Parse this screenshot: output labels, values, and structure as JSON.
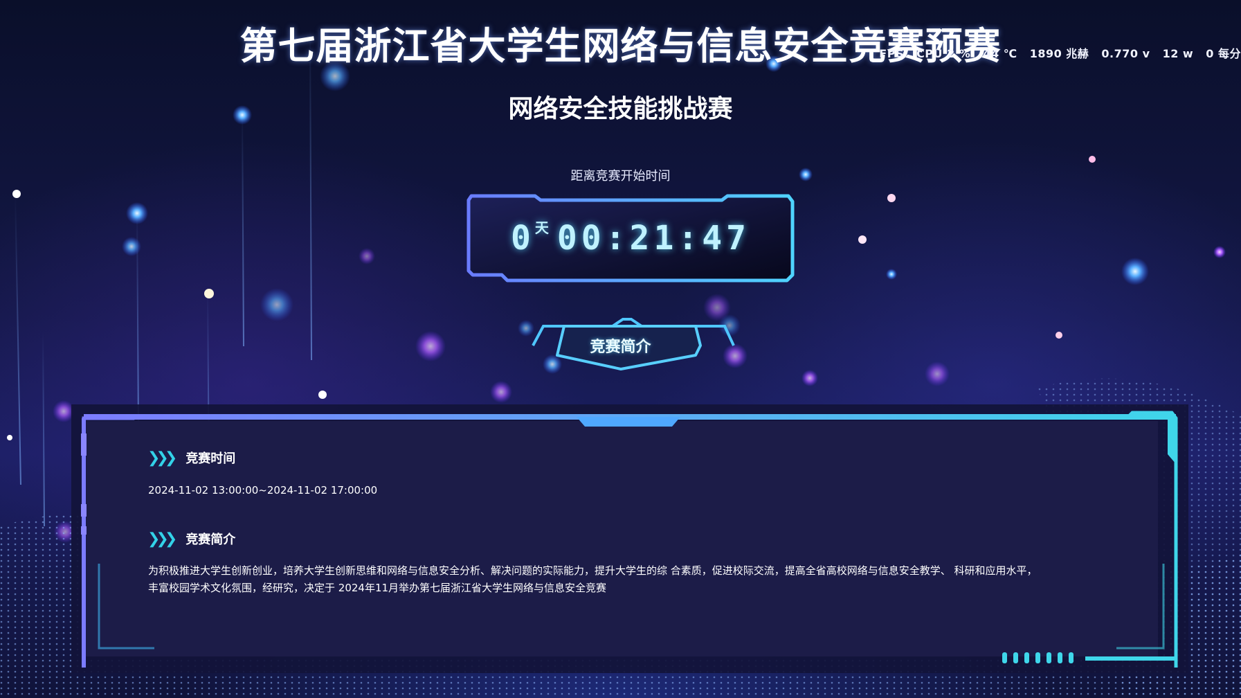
{
  "header": {
    "title": "第七届浙江省大学生网络与信息安全竞赛预赛",
    "subtitle": "网络安全技能挑战赛"
  },
  "perf_overlay": {
    "fps_label": "FPS",
    "cpu": "CPU 2 %",
    "temp": "44 ℃",
    "freq": "1890 兆赫",
    "volt": "0.770 v",
    "power": "12 w",
    "extra": "0 每分"
  },
  "countdown": {
    "label": "距离竞赛开始时间",
    "days": "0",
    "days_unit": "天",
    "time": "00:21:47"
  },
  "tab": {
    "label": "竞赛简介"
  },
  "info": {
    "time_heading": "竞赛时间",
    "time_value": "2024-11-02 13:00:00~2024-11-02 17:00:00",
    "intro_heading": "竞赛简介",
    "intro_line1": "为积极推进大学生创新创业，培养大学生创新思维和网络与信息安全分析、解决问题的实际能力，提升大学生的综 合素质，促进校际交流，提高全省高校网络与信息安全教学、 科研和应用水平，",
    "intro_line2": "丰富校园学术文化氛围，经研究，决定于 2024年11月举办第七届浙江省大学生网络与信息安全竞赛"
  },
  "colors": {
    "accent_cyan": "#3fd0ea",
    "accent_violet": "#7c7cff",
    "panel_bg": "#1c1c48"
  },
  "icons": {
    "section_marker": "triple-chevron-right-icon"
  }
}
